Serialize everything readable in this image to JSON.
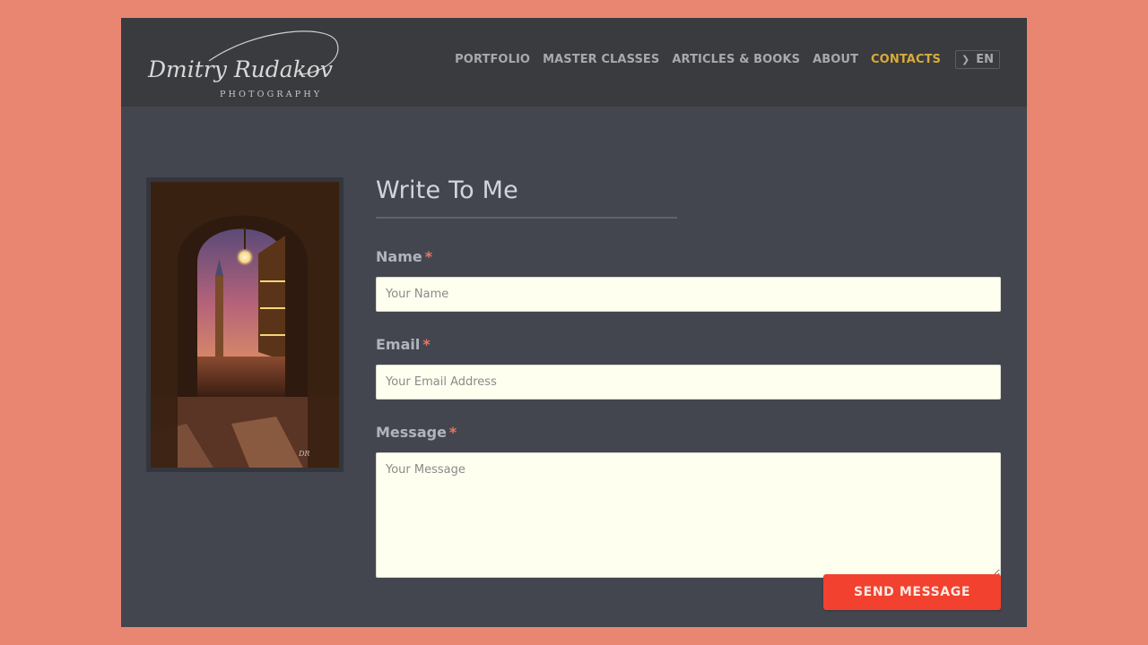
{
  "colors": {
    "page_background": "#e98672",
    "header_background": "#3a3b3e",
    "content_background": "#43464f",
    "nav_text": "#a8a9ac",
    "nav_active": "#d8ac3b",
    "input_background": "#fffff0",
    "required_marker": "#e8775f",
    "button_background": "#f2412e"
  },
  "header": {
    "logo": {
      "name": "Dmitry Rudakov",
      "tagline": "PHOTOGRAPHY"
    },
    "nav": [
      {
        "label": "PORTFOLIO",
        "active": false
      },
      {
        "label": "MASTER CLASSES",
        "active": false
      },
      {
        "label": "ARTICLES & BOOKS",
        "active": false
      },
      {
        "label": "ABOUT",
        "active": false
      },
      {
        "label": "CONTACTS",
        "active": true
      }
    ],
    "language": {
      "icon": "chevron-right-icon",
      "label": "EN"
    }
  },
  "photo": {
    "description": "Venice, St Mark's Square at dusk viewed through an arcade arch with a hanging lantern",
    "watermark": "Dmitry Rudakov signature"
  },
  "form": {
    "title": "Write To Me",
    "required_marker": "*",
    "fields": [
      {
        "label": "Name",
        "placeholder": "Your Name",
        "value": "",
        "required": true,
        "type": "text"
      },
      {
        "label": "Email",
        "placeholder": "Your Email Address",
        "value": "",
        "required": true,
        "type": "email"
      },
      {
        "label": "Message",
        "placeholder": "Your Message",
        "value": "",
        "required": true,
        "type": "textarea"
      }
    ],
    "submit_label": "SEND MESSAGE"
  }
}
